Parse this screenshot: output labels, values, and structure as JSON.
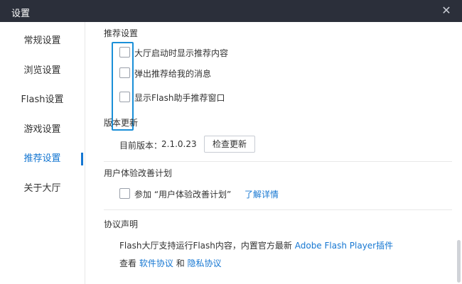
{
  "window": {
    "title": "设置",
    "close_icon": "close-icon"
  },
  "sidebar": {
    "items": [
      {
        "label": "常规设置"
      },
      {
        "label": "浏览设置"
      },
      {
        "label": "Flash设置"
      },
      {
        "label": "游戏设置"
      },
      {
        "label": "推荐设置",
        "active": true
      },
      {
        "label": "关于大厅"
      }
    ]
  },
  "recommend": {
    "title": "推荐设置",
    "options": [
      {
        "label": "大厅启动时显示推荐内容",
        "checked": false
      },
      {
        "label": "弹出推荐给我的消息",
        "checked": false
      },
      {
        "label": "显示Flash助手推荐窗口",
        "checked": false
      }
    ]
  },
  "update": {
    "title": "版本更新",
    "current_label": "目前版本：",
    "version": "2.1.0.23",
    "check_button": "检查更新"
  },
  "ux": {
    "title": "用户体验改善计划",
    "join_label": "参加 “用户体验改善计划”",
    "learn_more": "了解详情",
    "checked": false
  },
  "agreement": {
    "title": "协议声明",
    "line1_text": "Flash大厅支持运行Flash内容，内置官方最新",
    "line1_link": "Adobe Flash Player插件",
    "view_label": "查看",
    "software_link": "软件协议",
    "and_label": "和",
    "privacy_link": "隐私协议"
  },
  "colors": {
    "titlebar": "#2b2f3a",
    "accent": "#1677d2",
    "highlight": "#1a8fd8"
  }
}
